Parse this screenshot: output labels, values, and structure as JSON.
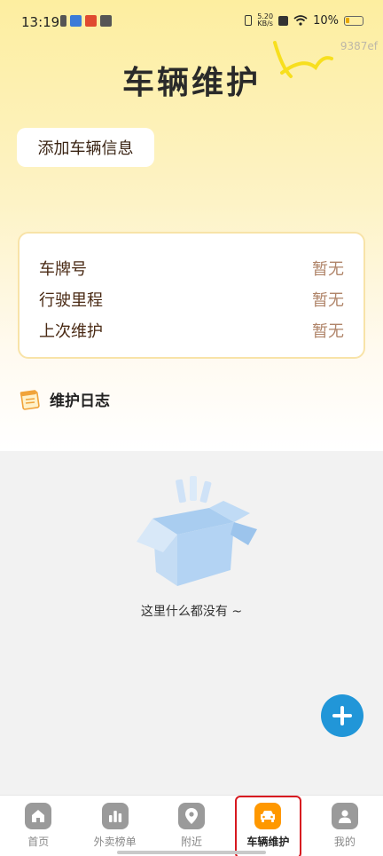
{
  "status_bar": {
    "time": "13:19",
    "speed_value": "5.20",
    "speed_unit": "KB/s",
    "battery": "10%"
  },
  "watermark": "9387ef",
  "page": {
    "title": "车辆维护",
    "add_vehicle_label": "添加车辆信息"
  },
  "vehicle_info": {
    "rows": [
      {
        "label": "车牌号",
        "value": "暂无"
      },
      {
        "label": "行驶里程",
        "value": "暂无"
      },
      {
        "label": "上次维护",
        "value": "暂无"
      }
    ]
  },
  "maintenance_log": {
    "title": "维护日志",
    "empty_text": "这里什么都没有 ~"
  },
  "bottom_nav": {
    "items": [
      {
        "label": "首页",
        "icon": "home-icon"
      },
      {
        "label": "外卖榜单",
        "icon": "chart-icon"
      },
      {
        "label": "附近",
        "icon": "location-pin-icon"
      },
      {
        "label": "车辆维护",
        "icon": "car-icon",
        "active": true
      },
      {
        "label": "我的",
        "icon": "user-icon"
      }
    ]
  },
  "colors": {
    "accent": "#ff9800",
    "fab": "#2196d8",
    "highlight_box": "#d71920"
  }
}
